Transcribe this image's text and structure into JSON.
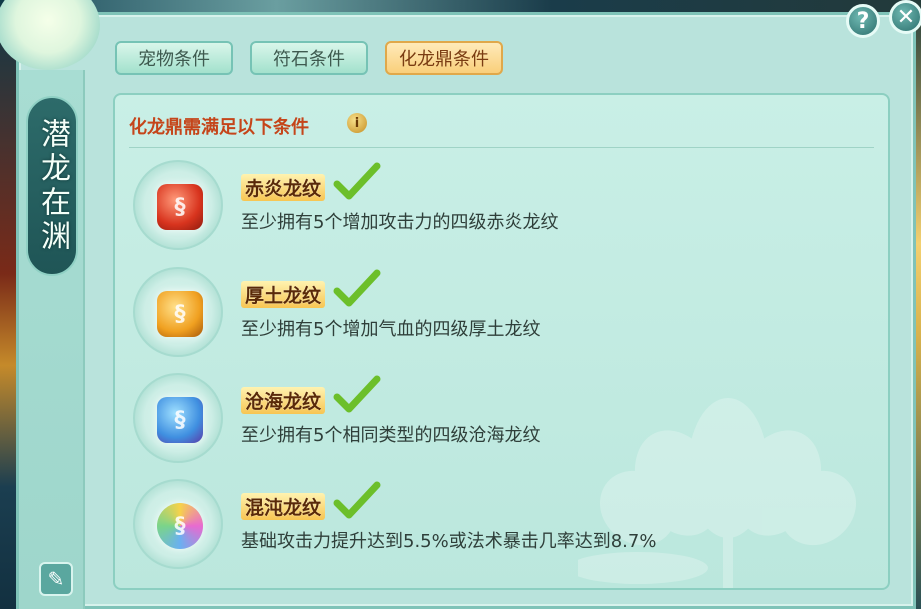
{
  "side_title": "潜龙在渊",
  "tabs": [
    {
      "label": "宠物条件",
      "active": false
    },
    {
      "label": "符石条件",
      "active": false
    },
    {
      "label": "化龙鼎条件",
      "active": true
    }
  ],
  "panel": {
    "title": "化龙鼎需满足以下条件",
    "info_icon": "i"
  },
  "conditions": [
    {
      "name": "赤炎龙纹",
      "desc": "至少拥有5个增加攻击力的四级赤炎龙纹",
      "met": true,
      "color": "#e04a2c"
    },
    {
      "name": "厚土龙纹",
      "desc": "至少拥有5个增加气血的四级厚土龙纹",
      "met": true,
      "color": "#f0a020"
    },
    {
      "name": "沧海龙纹",
      "desc": "至少拥有5个相同类型的四级沧海龙纹",
      "met": true,
      "color": "#3f8fe0"
    },
    {
      "name": "混沌龙纹",
      "desc": "基础攻击力提升达到5.5%或法术暴击几率达到8.7%",
      "met": true,
      "color": "#c98be6"
    }
  ],
  "buttons": {
    "help": "?",
    "close": "✕",
    "edit": "✎"
  },
  "colors": {
    "accent_tab": "#f9cf7b",
    "title_red": "#c5451a",
    "check_green": "#6cbf2a"
  }
}
